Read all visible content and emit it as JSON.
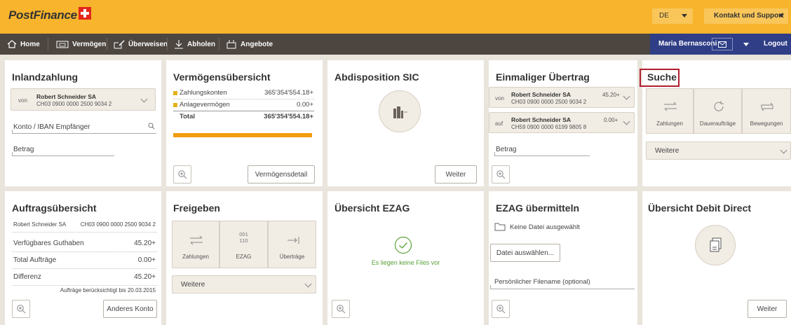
{
  "header": {
    "logo": "PostFinance",
    "language": "DE",
    "support": "Kontakt und Support"
  },
  "nav": {
    "items": [
      "Home",
      "Vermögen",
      "Überweisen",
      "Abholen",
      "Angebote"
    ],
    "user": "Maria Bernasconi",
    "logout": "Logout"
  },
  "inland": {
    "title": "Inlandzahlung",
    "from_label": "von",
    "from_name": "Robert Schneider SA",
    "from_iban": "CH03 0900 0000 2500 9034 2",
    "account_placeholder": "Konto / IBAN Empfänger",
    "amount_placeholder": "Betrag"
  },
  "vermoegen": {
    "title": "Vermögensübersicht",
    "rows": [
      {
        "label": "Zahlungskonten",
        "value": "365'354'554.18+"
      },
      {
        "label": "Anlagevermögen",
        "value": "0.00+"
      }
    ],
    "total_label": "Total",
    "total_value": "365'354'554.18+",
    "progress": 1.0,
    "detail_button": "Vermögensdetail",
    "colors": {
      "accent": "#f39c12",
      "square": "#e3b21b"
    }
  },
  "abdisposition": {
    "title": "Abdisposition SIC",
    "button": "Weiter"
  },
  "uebertrag": {
    "title": "Einmaliger Übertrag",
    "from_label": "von",
    "from_name": "Robert Schneider SA",
    "from_iban": "CH03 0900 0000 2500 9034 2",
    "from_amount": "45.20+",
    "to_label": "auf",
    "to_name": "Robert Schneider SA",
    "to_iban": "CH59 0900 0000 6199 9805 8",
    "to_amount": "0.00+",
    "amount_placeholder": "Betrag"
  },
  "suche": {
    "title": "Suche",
    "items": [
      "Zahlungen",
      "Daueraufträge",
      "Bewegungen"
    ],
    "more": "Weitere"
  },
  "auftrag": {
    "title": "Auftragsübersicht",
    "account_name": "Robert Schneider SA",
    "account_iban": "CH03 0900 0000 2500 9034 2",
    "rows": [
      {
        "label": "Verfügbares Guthaben",
        "value": "45.20+"
      },
      {
        "label": "Total Aufträge",
        "value": "0.00+"
      },
      {
        "label": "Differenz",
        "value": "45.20+"
      }
    ],
    "note": "Aufträge berücksichtigt bis 20.03.2015",
    "button": "Anderes Konto"
  },
  "freigeben": {
    "title": "Freigeben",
    "items": [
      "Zahlungen",
      "EZAG",
      "Überträge"
    ],
    "ezag_glyph_1": "001",
    "ezag_glyph_2": "110",
    "more": "Weitere"
  },
  "ezag": {
    "title": "Übersicht EZAG",
    "empty": "Es liegen keine Files vor",
    "colors": {
      "ok": "#5aa23a"
    }
  },
  "ezag_send": {
    "title": "EZAG übermitteln",
    "no_file": "Keine Datei ausgewählt",
    "choose": "Datei auswählen...",
    "filename_placeholder": "Persönlicher Filename (optional)"
  },
  "debit": {
    "title": "Übersicht Debit Direct",
    "button": "Weiter"
  }
}
